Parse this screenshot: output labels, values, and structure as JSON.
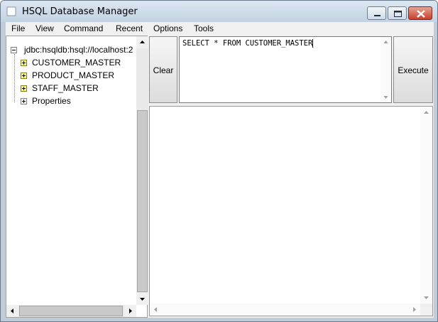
{
  "window": {
    "title": "HSQL Database Manager"
  },
  "menu": [
    "File",
    "View",
    "Command",
    "Recent",
    "Options",
    "Tools"
  ],
  "tree": {
    "root_label": "jdbc:hsqldb:hsql://localhost:2",
    "tables": [
      "CUSTOMER_MASTER",
      "PRODUCT_MASTER",
      "STAFF_MASTER"
    ],
    "properties_label": "Properties"
  },
  "editor": {
    "clear_label": "Clear",
    "execute_label": "Execute",
    "sql_text": "SELECT * FROM CUSTOMER_MASTER"
  },
  "colors": {
    "titlebar": "#c3d3e3",
    "close_button": "#c7402b",
    "table_expander": "#ffff99"
  }
}
